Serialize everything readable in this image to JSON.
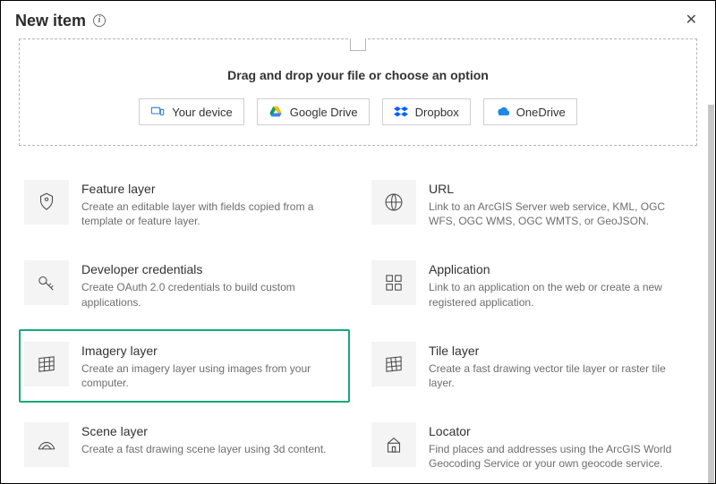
{
  "header": {
    "title": "New item"
  },
  "dropzone": {
    "text": "Drag and drop your file or choose an option",
    "sources": {
      "device": "Your device",
      "gdrive": "Google Drive",
      "dropbox": "Dropbox",
      "onedrive": "OneDrive"
    }
  },
  "options": [
    {
      "id": "feature-layer",
      "title": "Feature layer",
      "desc": "Create an editable layer with fields copied from a template or feature layer.",
      "highlight": false
    },
    {
      "id": "url",
      "title": "URL",
      "desc": "Link to an ArcGIS Server web service, KML, OGC WFS, OGC WMS, OGC WMTS, or GeoJSON.",
      "highlight": false
    },
    {
      "id": "developer-credentials",
      "title": "Developer credentials",
      "desc": "Create OAuth 2.0 credentials to build custom applications.",
      "highlight": false
    },
    {
      "id": "application",
      "title": "Application",
      "desc": "Link to an application on the web or create a new registered application.",
      "highlight": false
    },
    {
      "id": "imagery-layer",
      "title": "Imagery layer",
      "desc": "Create an imagery layer using images from your computer.",
      "highlight": true
    },
    {
      "id": "tile-layer",
      "title": "Tile layer",
      "desc": "Create a fast drawing vector tile layer or raster tile layer.",
      "highlight": false
    },
    {
      "id": "scene-layer",
      "title": "Scene layer",
      "desc": "Create a fast drawing scene layer using 3d content.",
      "highlight": false
    },
    {
      "id": "locator",
      "title": "Locator",
      "desc": "Find places and addresses using the ArcGIS World Geocoding Service or your own geocode service.",
      "highlight": false
    }
  ]
}
